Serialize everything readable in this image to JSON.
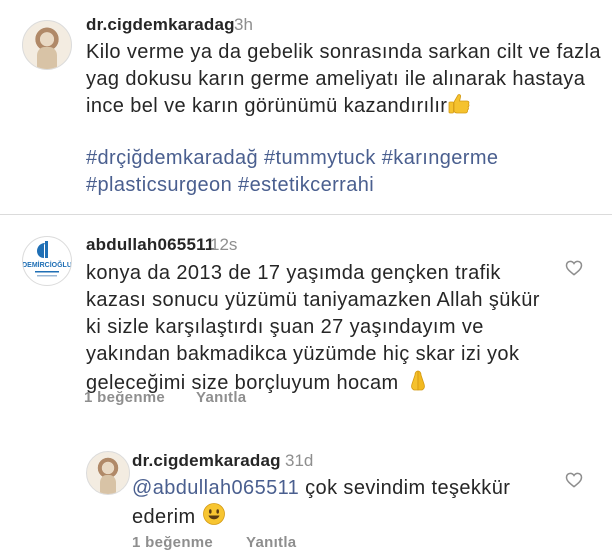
{
  "caption": {
    "username": "dr.cigdemkaradag",
    "time": "3h",
    "text_lines": [
      "Kilo verme ya da gebelik sonrasında sarkan cilt ve fazla",
      "yag dokusu karın germe ameliyatı ile alınarak hastaya",
      "ince bel ve karın görünümü kazandırılır"
    ],
    "emoji": "thumbs-up",
    "hashtag_lines": [
      "#drçiğdemkaradağ #tummytuck #karıngerme",
      "#plasticsurgeon #estetikcerrahi"
    ]
  },
  "comments": [
    {
      "username": "abdullah065511",
      "time": "12s",
      "avatar_text_main": "DEMİRCİOĞLU",
      "text_lines": [
        "konya da 2013 de 17 yaşımda gençken trafik",
        "kazası sonucu yüzümü taniyamazken Allah şükür",
        "ki sizle karşılaştırdı şuan 27 yaşındayım ve",
        "yakından bakmadikca yüzümde hiç skar izi yok",
        "geleceğimi size borçluyum hocam"
      ],
      "emoji": "folded-hands",
      "likes": "1 beğenme",
      "reply": "Yanıtla"
    }
  ],
  "reply": {
    "username": "dr.cigdemkaradag",
    "time": "31d",
    "mention": "@abdullah065511",
    "text_line1": " çok sevindim teşekkür",
    "text_line2": "ederim",
    "emoji": "smiling-face",
    "likes": "1 beğenme",
    "reply_label": "Yanıtla"
  },
  "colors": {
    "text": "#262626",
    "muted": "#8e8e8e",
    "link": "#4a5f8f",
    "divider": "#dbdbdb"
  }
}
